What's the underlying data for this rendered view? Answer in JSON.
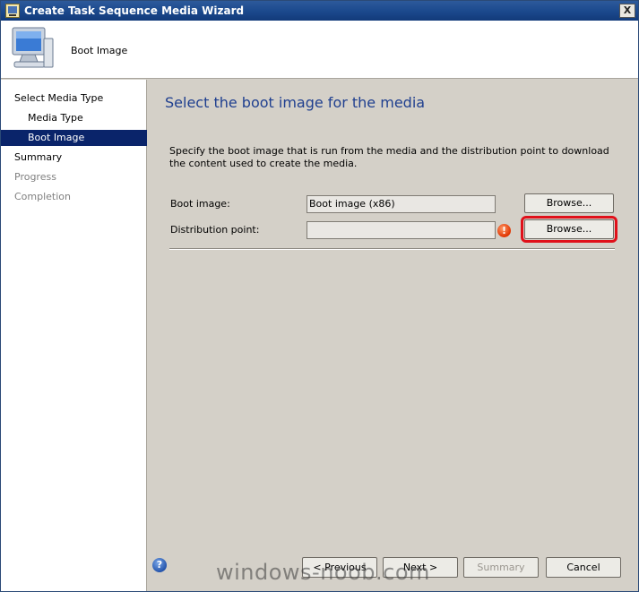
{
  "window": {
    "title": "Create Task Sequence Media Wizard",
    "close_label": "X"
  },
  "header": {
    "title": "Boot Image",
    "icon": "computer-monitor-icon"
  },
  "nav": {
    "items": [
      {
        "label": "Select Media Type",
        "state": "normal"
      },
      {
        "label": "Media Type",
        "state": "normal"
      },
      {
        "label": "Boot Image",
        "state": "active"
      },
      {
        "label": "Summary",
        "state": "normal"
      },
      {
        "label": "Progress",
        "state": "disabled"
      },
      {
        "label": "Completion",
        "state": "disabled"
      }
    ]
  },
  "main": {
    "heading": "Select the boot image for the media",
    "description": "Specify the boot image that is run from the media and the distribution point to download the content used to create the media.",
    "boot_image": {
      "label": "Boot image:",
      "value": "Boot image (x86)",
      "browse_label": "Browse..."
    },
    "distribution_point": {
      "label": "Distribution point:",
      "value": "",
      "browse_label": "Browse...",
      "warning_icon": "error-icon"
    }
  },
  "footer": {
    "help_icon": "help-icon",
    "previous_label": "< Previous",
    "next_label": "Next >",
    "summary_label": "Summary",
    "cancel_label": "Cancel"
  },
  "watermark": "windows-noob.com",
  "colors": {
    "accent_active": "#0a246a",
    "heading": "#1f3f8f",
    "highlight": "#e0101a"
  }
}
